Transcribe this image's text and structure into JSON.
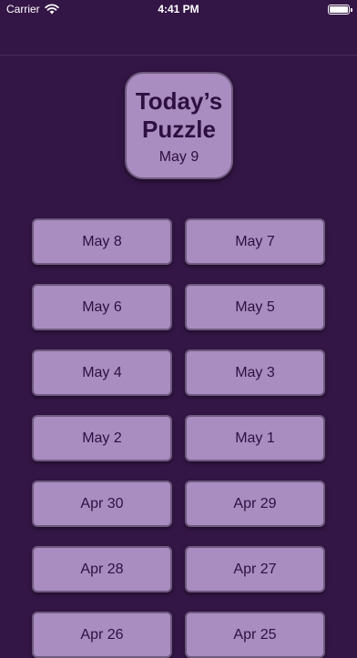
{
  "status_bar": {
    "carrier": "Carrier",
    "time": "4:41 PM"
  },
  "today": {
    "title": "Today’s Puzzle",
    "date": "May 9"
  },
  "puzzles": [
    {
      "label": "May 8"
    },
    {
      "label": "May 7"
    },
    {
      "label": "May 6"
    },
    {
      "label": "May 5"
    },
    {
      "label": "May 4"
    },
    {
      "label": "May 3"
    },
    {
      "label": "May 2"
    },
    {
      "label": "May 1"
    },
    {
      "label": "Apr 30"
    },
    {
      "label": "Apr 29"
    },
    {
      "label": "Apr 28"
    },
    {
      "label": "Apr 27"
    },
    {
      "label": "Apr 26"
    },
    {
      "label": "Apr 25"
    }
  ],
  "colors": {
    "background": "#341646",
    "button_fill": "#a98cc0",
    "button_border": "#6f5a80",
    "text": "#2e1040"
  }
}
